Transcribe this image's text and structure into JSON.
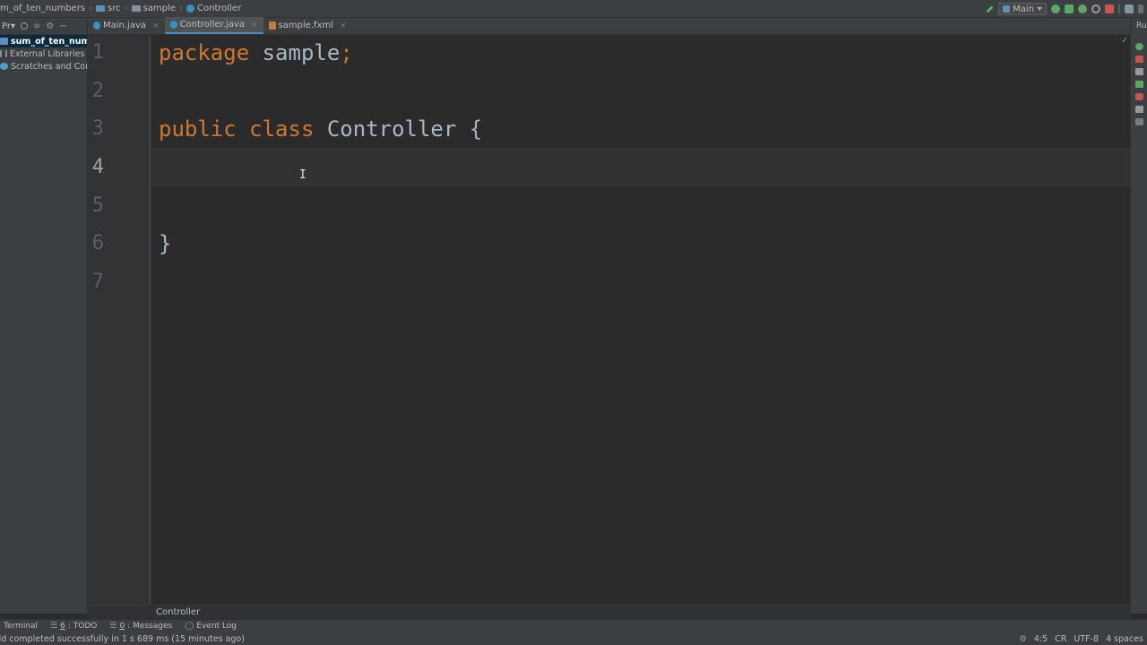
{
  "breadcrumbs": {
    "project": "m_of_ten_numbers",
    "src": "src",
    "package": "sample",
    "class": "Controller"
  },
  "run_toolbar": {
    "config": "Main"
  },
  "project_panel": {
    "header": "Pr▾",
    "items": [
      {
        "label": "sum_of_ten_numb",
        "selected": true,
        "icon": "module-folder-icon"
      },
      {
        "label": "External Libraries",
        "icon": "library-icon"
      },
      {
        "label": "Scratches and Cons",
        "icon": "scratches-icon"
      }
    ]
  },
  "tabs": [
    {
      "label": "Main.java",
      "icon": "java-class-icon"
    },
    {
      "label": "Controller.java",
      "icon": "java-class-icon",
      "active": true
    },
    {
      "label": "sample.fxml",
      "icon": "fxml-file-icon"
    }
  ],
  "editor": {
    "line_numbers": [
      "1",
      "2",
      "3",
      "4",
      "5",
      "6",
      "7"
    ],
    "current_line": "4",
    "lines": [
      {
        "kw": "package",
        "rest": " sample",
        "semi": ";"
      },
      {
        "text": ""
      },
      {
        "kw": "public class",
        "rest": " Controller {"
      },
      {
        "text": ""
      },
      {
        "text": ""
      },
      {
        "text": "}"
      },
      {
        "text": ""
      }
    ]
  },
  "bottom_breadcrumb": "Controller",
  "tool_windows": [
    {
      "label": "Terminal"
    },
    {
      "num": "6",
      "label": ": TODO"
    },
    {
      "num": "0",
      "label": ": Messages"
    },
    {
      "label": "Event Log"
    }
  ],
  "status": {
    "message": "ild completed successfully in 1 s 689 ms (15 minutes ago)",
    "position": "4:5",
    "line_sep": "CR",
    "encoding": "UTF-8",
    "indent": "4 spaces"
  },
  "right_strip": {
    "label": "Ru"
  },
  "colors": {
    "keyword": "#cc7832",
    "identifier": "#a9b7c6",
    "background": "#2b2b2b",
    "panel": "#3c3f41",
    "accent": "#4a88c7"
  }
}
